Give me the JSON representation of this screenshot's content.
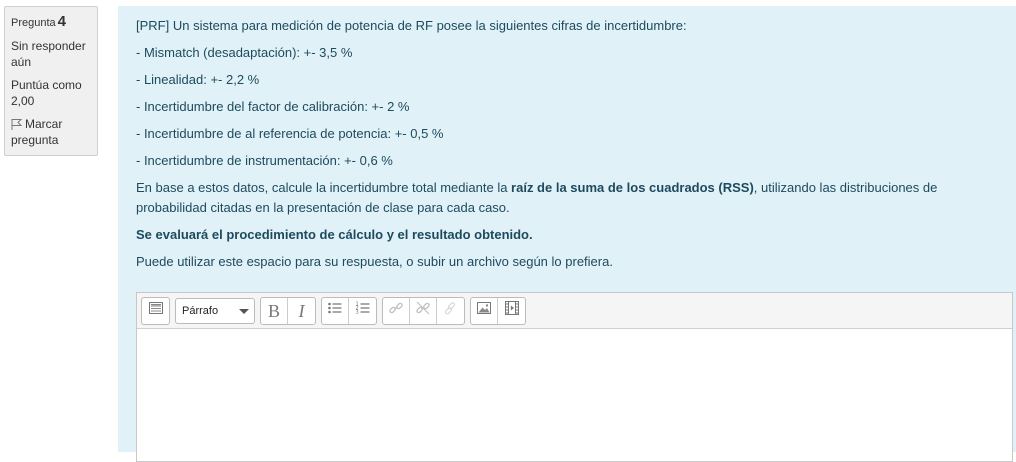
{
  "info": {
    "question_label": "Pregunta",
    "question_number": "4",
    "state": "Sin responder aún",
    "grade": "Puntúa como 2,00",
    "flag_label": "Marcar pregunta"
  },
  "question": {
    "intro": "[PRF] Un sistema para medición de potencia de RF posee la siguientes cifras de incertidumbre:",
    "items": [
      "- Mismatch (desadaptación): +- 3,5 %",
      "- Linealidad: +- 2,2 %",
      "- Incertidumbre del factor de calibración: +- 2 %",
      "- Incertidumbre de al referencia de potencia: +- 0,5 %",
      "- Incertidumbre de instrumentación: +- 0,6 %"
    ],
    "instruction_pre": "En base a estos datos, calcule la incertidumbre total mediante la ",
    "instruction_bold": "raíz de la suma de los cuadrados (RSS)",
    "instruction_post": ", utilizando las distribuciones de probabilidad citadas en la presentación de clase para cada caso.",
    "evaluation": "Se evaluará el procedimiento de cálculo y el resultado obtenido.",
    "answer_hint": "Puede utilizar este espacio para su respuesta, o subir un archivo según lo prefiera."
  },
  "editor": {
    "paragraph_format": "Párrafo",
    "bold_glyph": "B",
    "italic_glyph": "I",
    "content": ""
  }
}
